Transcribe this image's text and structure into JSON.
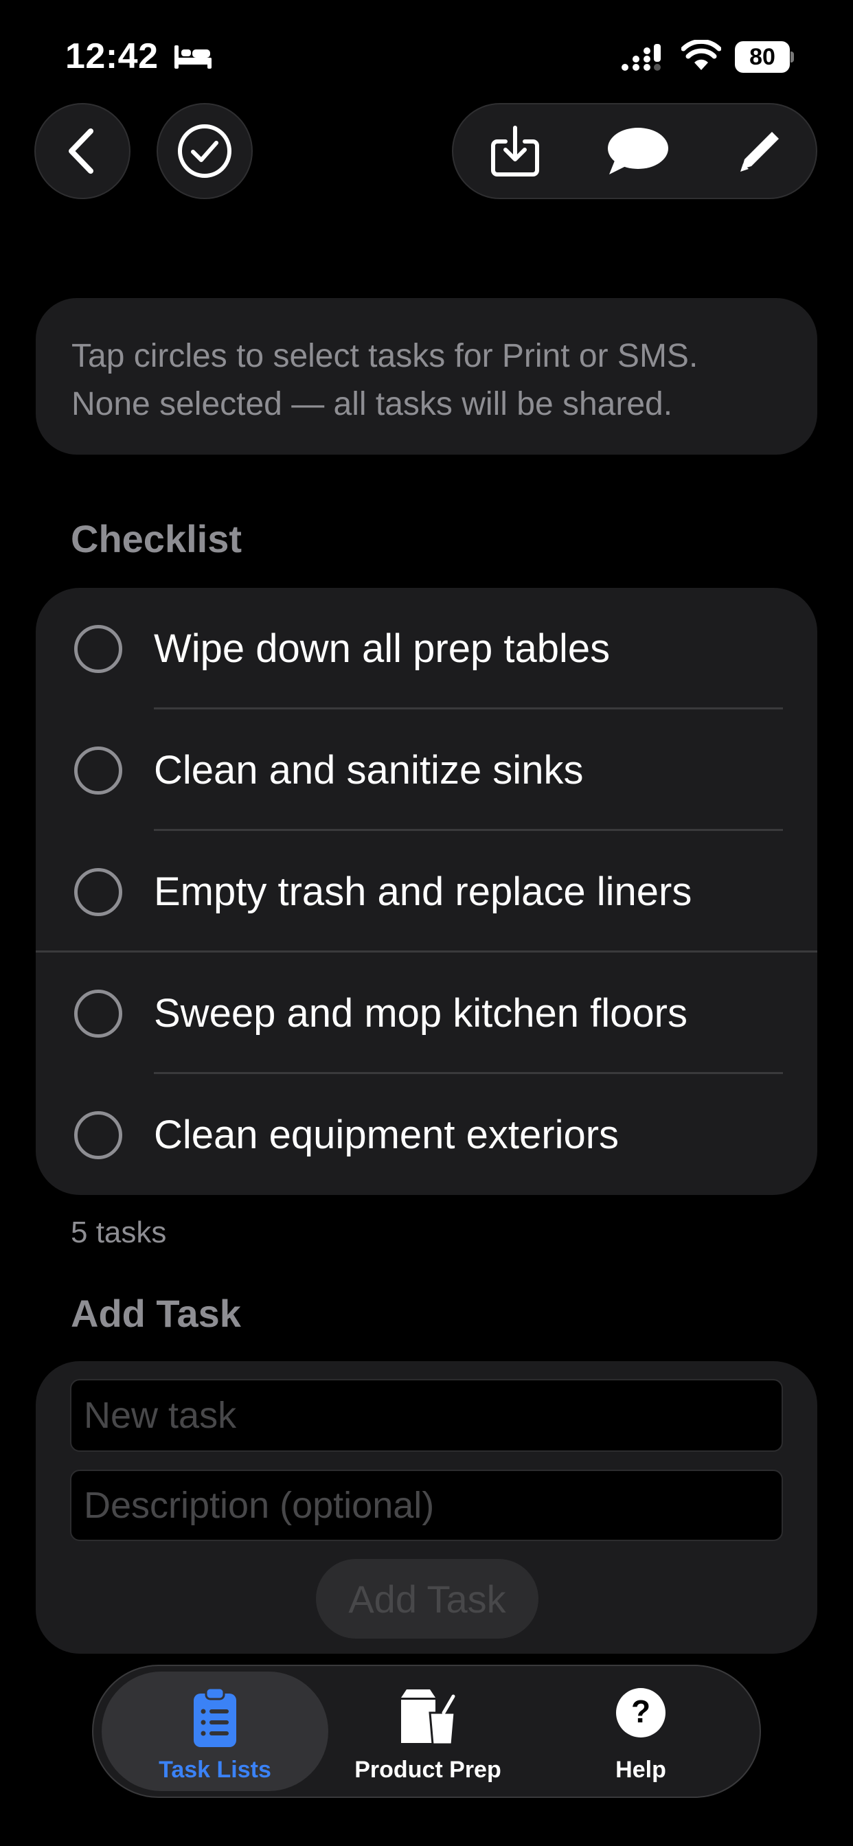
{
  "status_bar": {
    "time": "12:42",
    "battery": "80"
  },
  "info": {
    "line1": "Tap circles to select tasks for Print or SMS.",
    "line2": "None selected — all tasks will be shared."
  },
  "checklist": {
    "title": "Checklist",
    "tasks": [
      {
        "label": "Wipe down all prep tables"
      },
      {
        "label": "Clean and sanitize sinks"
      },
      {
        "label": "Empty trash and replace liners"
      },
      {
        "label": "Sweep and mop kitchen floors"
      },
      {
        "label": "Clean equipment exteriors"
      }
    ],
    "count_label": "5 tasks"
  },
  "add_task": {
    "title": "Add Task",
    "task_placeholder": "New task",
    "description_placeholder": "Description (optional)",
    "button_label": "Add Task"
  },
  "tabs": [
    {
      "label": "Task Lists",
      "icon": "clipboard-list-icon",
      "active": true
    },
    {
      "label": "Product Prep",
      "icon": "containers-icon",
      "active": false
    },
    {
      "label": "Help",
      "icon": "question-icon",
      "active": false
    }
  ],
  "colors": {
    "accent": "#3b82f6",
    "card": "#1c1c1e",
    "secondary_text": "#8e8e93"
  }
}
